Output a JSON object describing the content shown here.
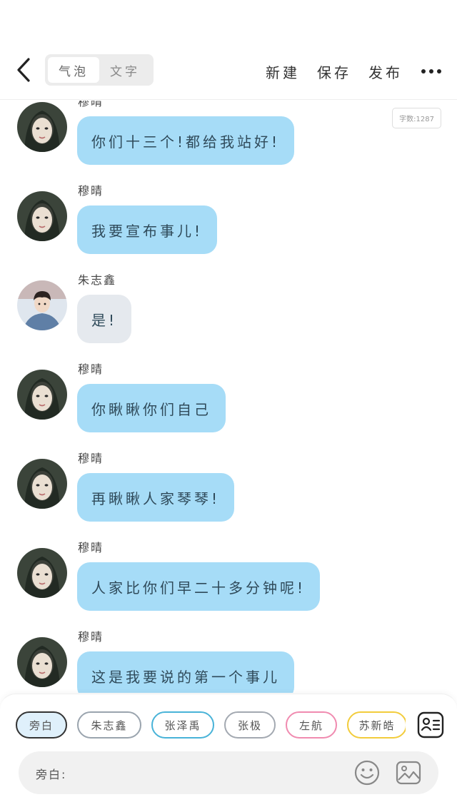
{
  "header": {
    "tabs": [
      {
        "label": "气泡",
        "active": true
      },
      {
        "label": "文字",
        "active": false
      }
    ],
    "actions": {
      "new_label": "新建",
      "save_label": "保存",
      "publish_label": "发布"
    },
    "icons": {
      "back": "back-arrow-icon",
      "more": "more-dots-icon"
    }
  },
  "word_count": "字数:1287",
  "colors": {
    "bubble_blue": "#a6dcf7",
    "bubble_grey": "#e5e9ee"
  },
  "messages": [
    {
      "name": "穆晴",
      "text": "你们十三个!都给我站好!",
      "style": "blue",
      "avatar": "girl"
    },
    {
      "name": "穆晴",
      "text": "我要宣布事儿!",
      "style": "blue",
      "avatar": "girl"
    },
    {
      "name": "朱志鑫",
      "text": "是!",
      "style": "grey",
      "avatar": "boy"
    },
    {
      "name": "穆晴",
      "text": "你瞅瞅你们自己",
      "style": "blue",
      "avatar": "girl"
    },
    {
      "name": "穆晴",
      "text": "再瞅瞅人家琴琴!",
      "style": "blue",
      "avatar": "girl"
    },
    {
      "name": "穆晴",
      "text": "人家比你们早二十多分钟呢!",
      "style": "blue",
      "avatar": "girl"
    },
    {
      "name": "穆晴",
      "text": "这是我要说的第一个事儿",
      "style": "blue",
      "avatar": "girl"
    }
  ],
  "characters": [
    {
      "label": "旁白",
      "color": "#333333",
      "fill": "#dff0fb",
      "selected": true
    },
    {
      "label": "朱志鑫",
      "color": "#9aa4ae",
      "fill": "#ffffff",
      "selected": false
    },
    {
      "label": "张泽禹",
      "color": "#49b3d8",
      "fill": "#ffffff",
      "selected": false
    },
    {
      "label": "张极",
      "color": "#a3a9b1",
      "fill": "#ffffff",
      "selected": false
    },
    {
      "label": "左航",
      "color": "#f08bb0",
      "fill": "#ffffff",
      "selected": false
    },
    {
      "label": "苏新皓",
      "color": "#f2cc3c",
      "fill": "#ffffff",
      "selected": false
    }
  ],
  "input": {
    "label": "旁白:",
    "value": ""
  },
  "bottom_icons": {
    "card": "character-card-icon",
    "emoji": "emoji-icon",
    "image": "image-icon"
  }
}
